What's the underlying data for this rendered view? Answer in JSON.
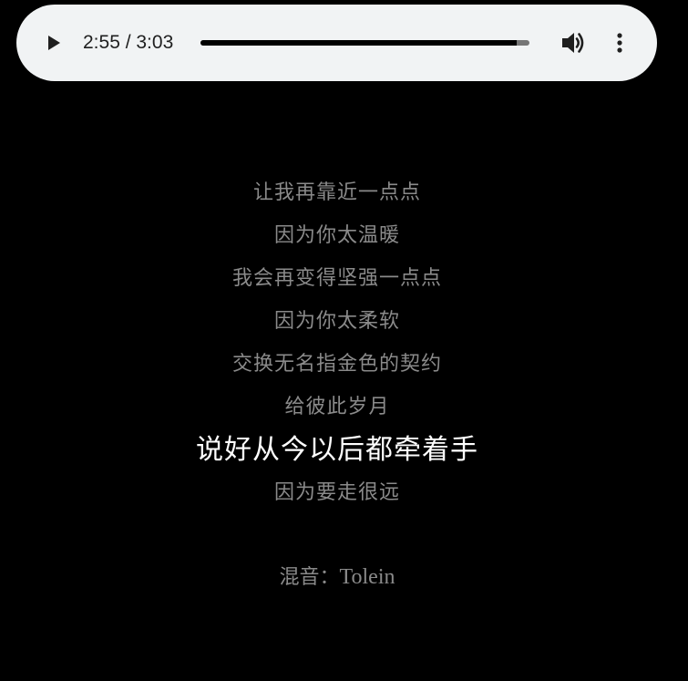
{
  "player": {
    "time_display": "2:55 / 3:03",
    "progress_fraction": 0.9617,
    "play_icon": "play-icon",
    "volume_icon": "volume-icon",
    "more_icon": "more-vert-icon",
    "colors": {
      "background": "#f1f3f4",
      "track": "#757575",
      "fill": "#000000"
    }
  },
  "lyrics": {
    "lines": [
      "让我再靠近一点点",
      "因为你太温暖",
      "我会再变得坚强一点点",
      "因为你太柔软",
      "交换无名指金色的契约",
      "给彼此岁月",
      "说好从今以后都牵着手",
      "因为要走很远"
    ],
    "current_index": 6,
    "colors": {
      "inactive": "#8a8a8a",
      "active": "#ffffff"
    }
  },
  "credit": {
    "label": "混音：",
    "name": "Tolein"
  }
}
